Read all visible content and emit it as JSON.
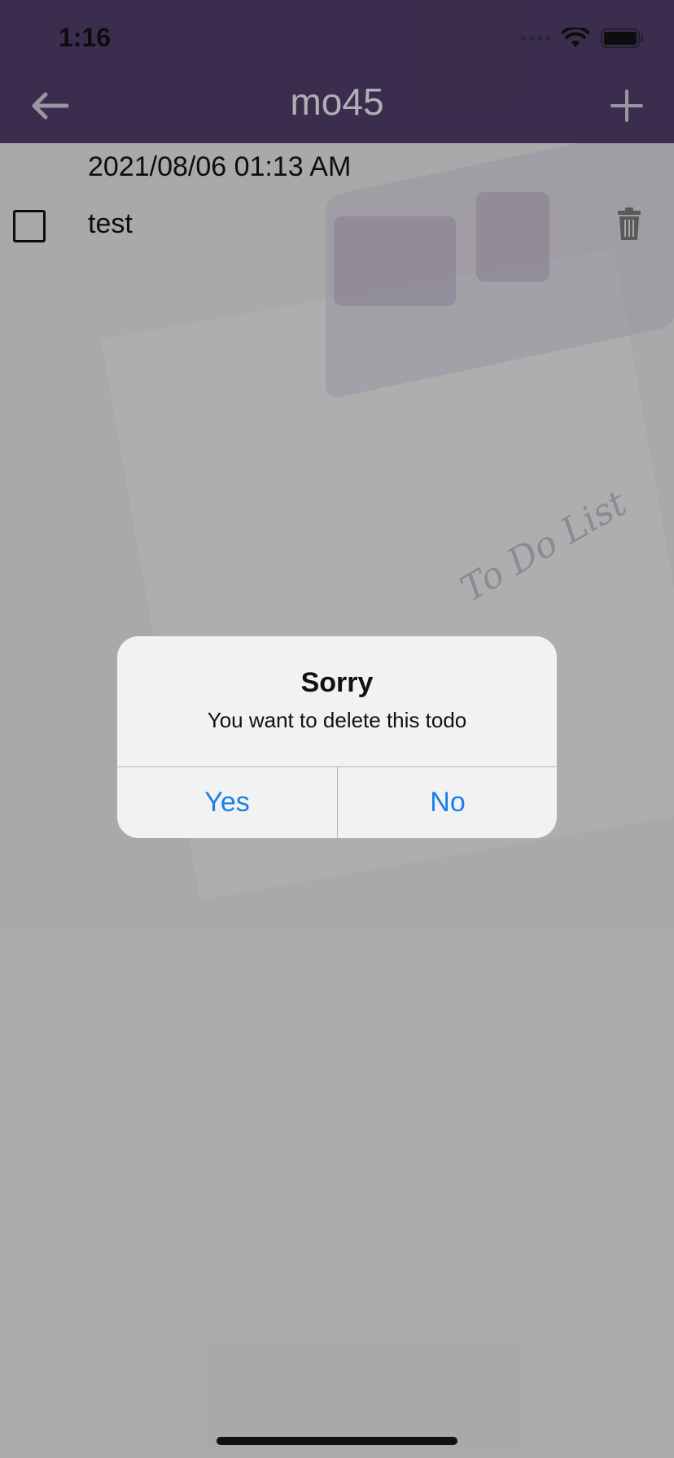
{
  "status_bar": {
    "time": "1:16"
  },
  "header": {
    "title": "mo45"
  },
  "todo": {
    "date": "2021/08/06 01:13 AM",
    "text": "test"
  },
  "background_decoration": {
    "note_text": "To Do List"
  },
  "alert": {
    "title": "Sorry",
    "message": "You want to delete this todo",
    "yes_label": "Yes",
    "no_label": "No"
  },
  "colors": {
    "header_bg": "#48385e",
    "accent_blue": "#1a7fe8"
  },
  "icons": {
    "back": "back-arrow-icon",
    "add": "plus-icon",
    "delete": "trash-icon",
    "wifi": "wifi-icon",
    "battery": "battery-icon",
    "signal": "signal-icon"
  }
}
